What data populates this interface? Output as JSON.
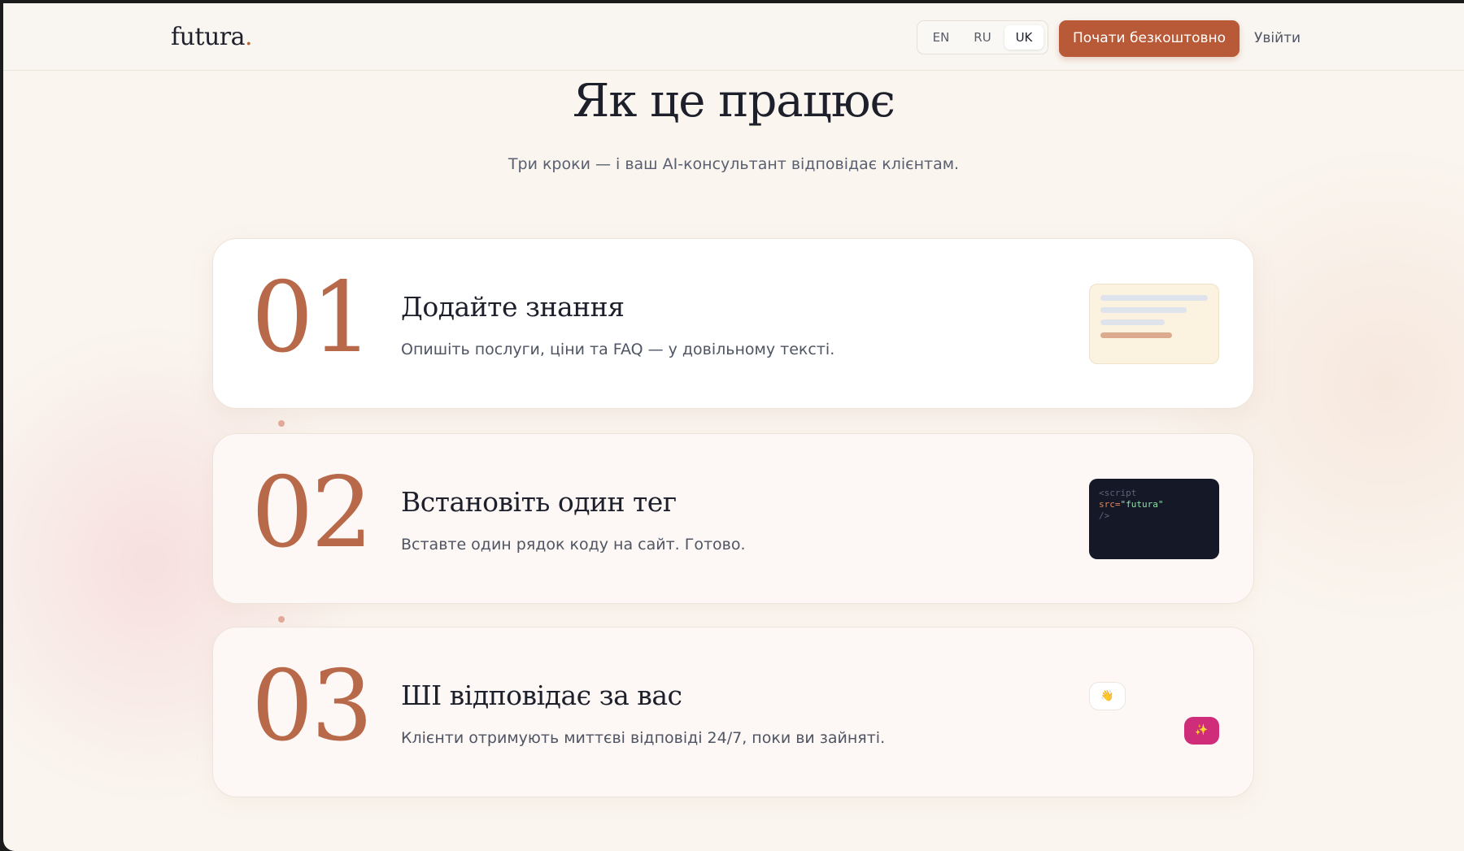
{
  "header": {
    "logo_text": "futura",
    "logo_dot": ".",
    "languages": [
      {
        "label": "EN",
        "active": false
      },
      {
        "label": "RU",
        "active": false
      },
      {
        "label": "UK",
        "active": true
      }
    ],
    "cta_label": "Почати безкоштовно",
    "login_label": "Увійти"
  },
  "section": {
    "title": "Як це працює",
    "subtitle": "Три кроки — і ваш AI-консультант відповідає клієнтам."
  },
  "steps": [
    {
      "number": "01",
      "title": "Додайте знання",
      "description": "Опишіть послуги, ціни та FAQ — у довільному тексті.",
      "illustration": "document-lines"
    },
    {
      "number": "02",
      "title": "Встановіть один тег",
      "description": "Вставте один рядок коду на сайт. Готово.",
      "illustration": "code-snippet",
      "code": {
        "line1": "<script",
        "line2_attr": "src=",
        "line2_str": "\"futura\"",
        "line3": "/>"
      }
    },
    {
      "number": "03",
      "title": "ШІ відповідає за вас",
      "description": "Клієнти отримують миттєві відповіді 24/7, поки ви зайняті.",
      "illustration": "chat-bubbles",
      "chat": {
        "user_emoji": "👋",
        "ai_emoji": "✨"
      }
    }
  ],
  "colors": {
    "accent": "#b85a37",
    "step_number": "#b8694a",
    "text_dark": "#1d1f2b",
    "background": "#faf5ef",
    "ai_bubble": "#cf2d79",
    "code_bg": "#141827"
  }
}
